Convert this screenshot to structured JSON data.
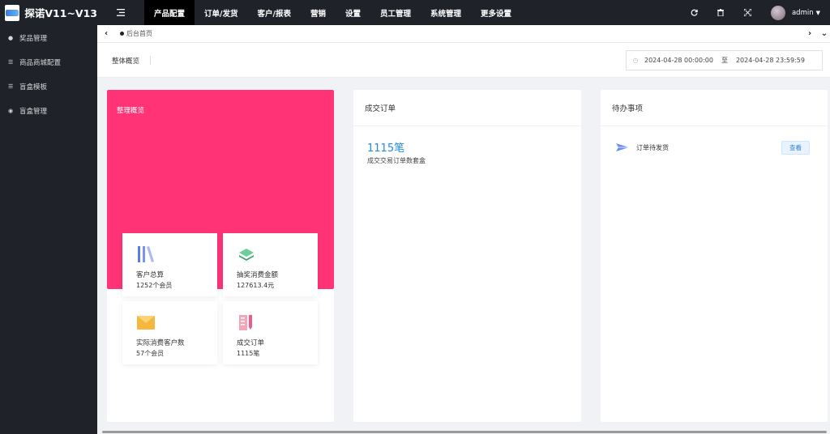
{
  "app": {
    "title": "探诺V11~V13"
  },
  "nav": {
    "items": [
      {
        "label": "产品配置",
        "active": true
      },
      {
        "label": "订单/发货",
        "active": false
      },
      {
        "label": "客户/报表",
        "active": false
      },
      {
        "label": "营销",
        "active": false
      },
      {
        "label": "设置",
        "active": false
      },
      {
        "label": "员工管理",
        "active": false
      },
      {
        "label": "系统管理",
        "active": false
      },
      {
        "label": "更多设置",
        "active": false
      }
    ]
  },
  "user": {
    "name": "admin"
  },
  "sidebar": {
    "items": [
      {
        "label": "奖品管理",
        "icon": "apple-icon"
      },
      {
        "label": "商品商城配置",
        "icon": "list-icon"
      },
      {
        "label": "盲盒模板",
        "icon": "list-icon"
      },
      {
        "label": "盲盒管理",
        "icon": "circle-icon"
      }
    ]
  },
  "tabs": {
    "current": "后台首页"
  },
  "subheader": {
    "title": "整体概览",
    "date_start": "2024-04-28 00:00:00",
    "date_sep": "至",
    "date_end": "2024-04-28 23:59:59"
  },
  "overview": {
    "title": "整理概览",
    "stats": [
      {
        "label": "客户总算",
        "value": "1252个会员",
        "icon": "books-icon"
      },
      {
        "label": "抽奖消费金额",
        "value": "127613.4元",
        "icon": "layers-icon"
      },
      {
        "label": "实际消费客户数",
        "value": "57个会员",
        "icon": "envelope-icon"
      },
      {
        "label": "成交订单",
        "value": "1115笔",
        "icon": "notebook-icon"
      }
    ]
  },
  "orders": {
    "title": "成交订单",
    "count": "1115笔",
    "desc": "成交交易订单数套盒"
  },
  "todo": {
    "title": "待办事项",
    "items": [
      {
        "label": "订单待发货",
        "button": "查看"
      }
    ]
  },
  "colors": {
    "pink": "#ff3376",
    "dark": "#20222a",
    "accent": "#1e8ce6"
  }
}
